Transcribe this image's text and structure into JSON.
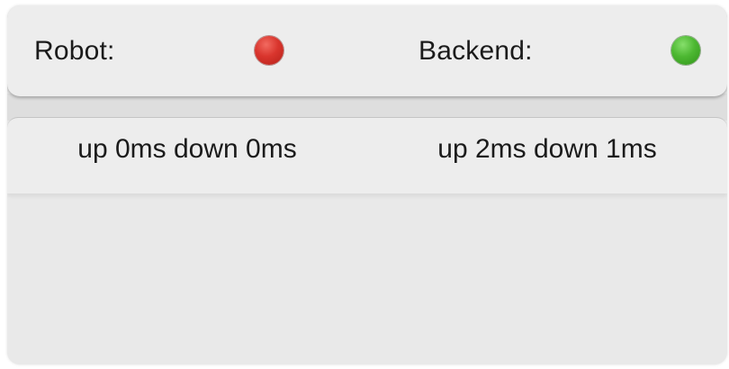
{
  "status": {
    "robot": {
      "label": "Robot:",
      "indicator_state": "disconnected",
      "indicator_color": "#d9352d"
    },
    "backend": {
      "label": "Backend:",
      "indicator_state": "connected",
      "indicator_color": "#4db832"
    }
  },
  "latency": {
    "robot": "up 0ms down 0ms",
    "backend": "up 2ms down 1ms"
  }
}
